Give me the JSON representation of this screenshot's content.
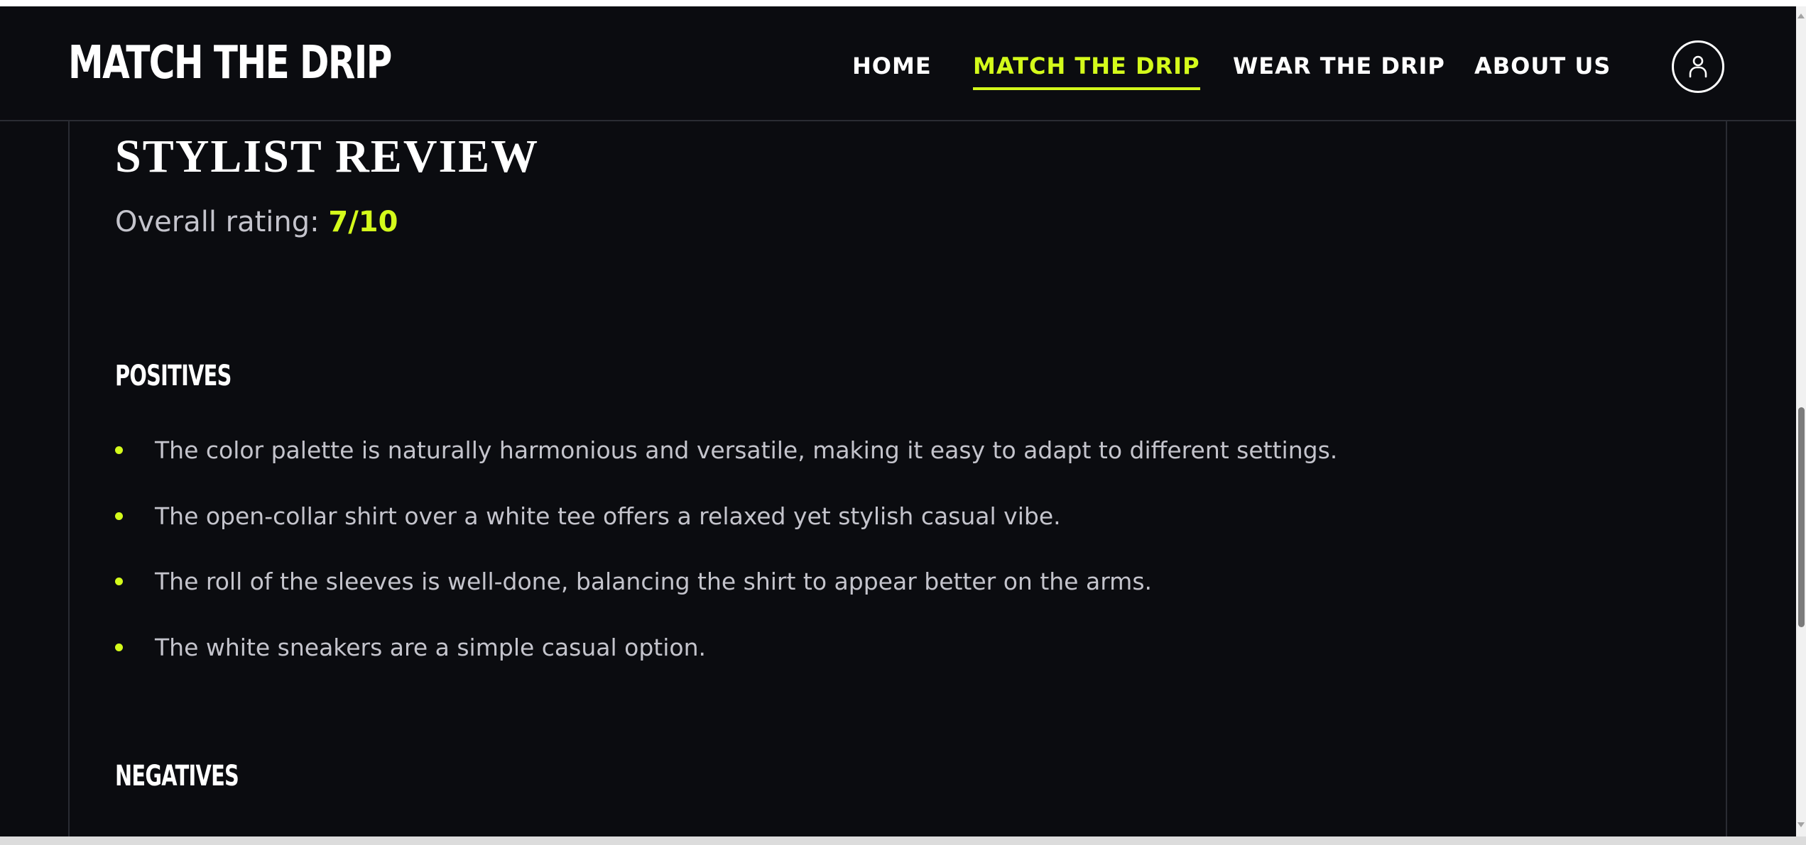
{
  "header": {
    "logo": "MATCH THE DRIP",
    "nav": [
      {
        "label": "HOME",
        "active": false
      },
      {
        "label": "MATCH THE DRIP",
        "active": true
      },
      {
        "label": "WEAR THE DRIP",
        "active": false
      },
      {
        "label": "ABOUT US",
        "active": false
      }
    ],
    "account_icon": "user-icon"
  },
  "review": {
    "title": "STYLIST REVIEW",
    "rating_label": "Overall rating:",
    "rating_value": "7/10",
    "positives": {
      "heading": "POSITIVES",
      "items": [
        "The color palette is naturally harmonious and versatile, making it easy to adapt to different settings.",
        "The open-collar shirt over a white tee offers a relaxed yet stylish casual vibe.",
        "The roll of the sleeves is well-done, balancing the shirt to appear better on the arms.",
        "The white sneakers are a simple casual option."
      ]
    },
    "negatives": {
      "heading": "NEGATIVES"
    }
  },
  "colors": {
    "background": "#0b0c10",
    "accent": "#d4fb1b",
    "text_primary": "#ffffff",
    "text_secondary": "#c4c4cc"
  }
}
